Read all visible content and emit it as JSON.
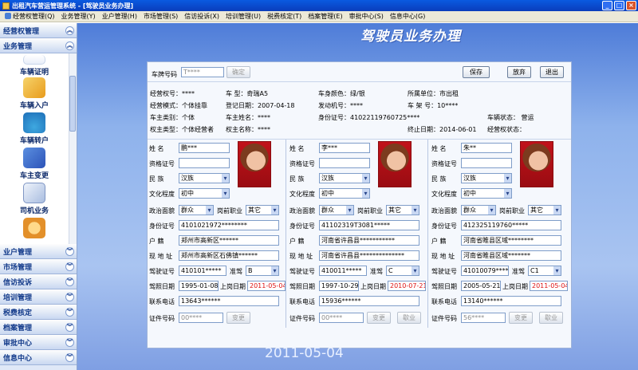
{
  "window": {
    "title": "出租汽车营运管理系统 - [驾驶员业务办理]"
  },
  "menu": [
    {
      "label": "经营权管理(Q)"
    },
    {
      "label": "业务管理(Y)"
    },
    {
      "label": "业户管理(H)"
    },
    {
      "label": "市场管理(S)"
    },
    {
      "label": "信访投诉(X)"
    },
    {
      "label": "培训管理(U)"
    },
    {
      "label": "税费核定(T)"
    },
    {
      "label": "档案管理(E)"
    },
    {
      "label": "审批中心(S)"
    },
    {
      "label": "信息中心(G)"
    }
  ],
  "sidebar": {
    "top": [
      {
        "label": "经营权管理"
      },
      {
        "label": "业务管理"
      }
    ],
    "items": [
      {
        "label": "车辆证明",
        "icon": "vehicle-certificate-icon"
      },
      {
        "label": "车辆入户",
        "icon": "pencil-icon"
      },
      {
        "label": "车辆转户",
        "icon": "palm-icon"
      },
      {
        "label": "车主变更",
        "icon": "book-icon"
      },
      {
        "label": "司机业务",
        "icon": "driver-doc-icon"
      },
      {
        "label": "",
        "icon": "compass-icon"
      }
    ],
    "bottom": [
      {
        "label": "业户管理"
      },
      {
        "label": "市场管理"
      },
      {
        "label": "信访投诉"
      },
      {
        "label": "培训管理"
      },
      {
        "label": "税费核定"
      },
      {
        "label": "档案管理"
      },
      {
        "label": "审批中心"
      },
      {
        "label": "信息中心"
      }
    ]
  },
  "banner": {
    "title": "驾驶员业务办理",
    "date": "2011-05-04"
  },
  "toolbar": {
    "plate_label": "车牌号码",
    "plate_value": "T****",
    "confirm": "确定",
    "save": "保存",
    "discard": "放弃",
    "exit": "退出"
  },
  "info": {
    "r1": [
      "经营权号：****",
      "车    型：奇瑞A5",
      "车身颜色：绿/银",
      "所属单位：市出租"
    ],
    "r2": [
      "经营模式：个体挂靠",
      "登记日期：2007-04-18",
      "发动机号：****",
      "车  架  号：10****"
    ],
    "r3": [
      "车主类别：个体",
      "车主姓名：****",
      "身份证号：41022119760725****",
      "车辆状态：  营运"
    ],
    "r4": [
      "权主类型：个体经营者",
      "权主名称：****",
      "终止日期：2014-06-01",
      "经营权状态："
    ]
  },
  "labels": {
    "name": "姓    名",
    "cert": "资格证号",
    "nation": "民    族",
    "edu": "文化程度",
    "politic": "政治面貌",
    "prejob": "岗前职业",
    "idno": "身份证号",
    "huji": "户    籍",
    "addr": "现 地 址",
    "license": "驾驶证号",
    "class": "准驾",
    "lic_date": "驾照日期",
    "onduty": "上岗日期",
    "phone": "联系电话",
    "docno": "证件号码",
    "change": "变更",
    "release": "歇业"
  },
  "drivers": [
    {
      "name": "鹏***",
      "cert": "",
      "nation": "汉族",
      "edu": "初中",
      "politic": "群众",
      "prejob": "其它",
      "idno": "4101021972********",
      "huji": "郑州市高新区******",
      "addr": "郑州市高新区石佛镇******",
      "license": "410101*****",
      "class": "B",
      "lic_date": "1995-01-08",
      "onduty": "2011-05-04",
      "phone": "13643******",
      "docno": "00****"
    },
    {
      "name": "李***",
      "cert": "",
      "nation": "汉族",
      "edu": "初中",
      "politic": "群众",
      "prejob": "其它",
      "idno": "41102319T3081*****",
      "huji": "河南省许昌县***********",
      "addr": "河南省许昌县**************",
      "license": "410011*****",
      "class": "C",
      "lic_date": "1997-10-29",
      "onduty": "2010-07-21",
      "phone": "15936******",
      "docno": "00****"
    },
    {
      "name": "朱**",
      "cert": "",
      "nation": "汉族",
      "edu": "初中",
      "politic": "群众",
      "prejob": "其它",
      "idno": "412325119760*****",
      "huji": "河南省睢县区域********",
      "addr": "河南省睢县区域*******",
      "license": "41010079*****",
      "class": "C1",
      "lic_date": "2005-05-21",
      "onduty": "2011-05-04",
      "phone": "13140******",
      "docno": "56****"
    }
  ]
}
